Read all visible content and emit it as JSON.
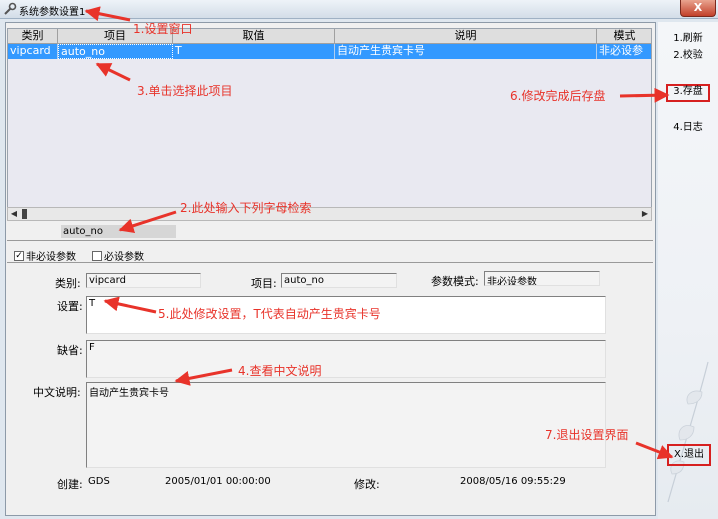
{
  "window": {
    "title": "系统参数设置1",
    "close_label": "X"
  },
  "grid": {
    "columns": [
      "类别",
      "项目",
      "取值",
      "说明",
      "模式"
    ],
    "rows": [
      {
        "category": "vipcard",
        "item": "auto_no",
        "value": "T",
        "description": "自动产生贵宾卡号",
        "mode": "非必设参"
      }
    ]
  },
  "search": {
    "value": "auto_no"
  },
  "filters": {
    "optional": {
      "label": "非必设参数",
      "checked": true
    },
    "required": {
      "label": "必设参数",
      "checked": false
    }
  },
  "form": {
    "category_label": "类别:",
    "category_value": "vipcard",
    "item_label": "项目:",
    "item_value": "auto_no",
    "mode_label": "参数模式:",
    "mode_value": "非必设参数",
    "setting_label": "设置:",
    "setting_value": "T",
    "default_label": "缺省:",
    "default_value": "F",
    "desc_label": "中文说明:",
    "desc_value": "自动产生贵宾卡号",
    "created_label": "创建:",
    "created_by": "GDS",
    "created_time": "2005/01/01 00:00:00",
    "modified_label": "修改:",
    "modified_time": "2008/05/16 09:55:29"
  },
  "toolbar": {
    "refresh": "1.刷新",
    "verify": "2.校验",
    "save": "3.存盘",
    "log": "4.日志",
    "exit": "X.退出"
  },
  "annotations": {
    "a1": "1.设置窗口",
    "a2": "2.此处输入下列字母检索",
    "a3": "3.单击选择此项目",
    "a4": "4.查看中文说明",
    "a5": "5.此处修改设置，T代表自动产生贵宾卡号",
    "a6": "6.修改完成后存盘",
    "a7": "7.退出设置界面"
  },
  "colors": {
    "selection": "#3399ff",
    "annotation": "#e8332a",
    "highlight_box": "#d62020"
  }
}
